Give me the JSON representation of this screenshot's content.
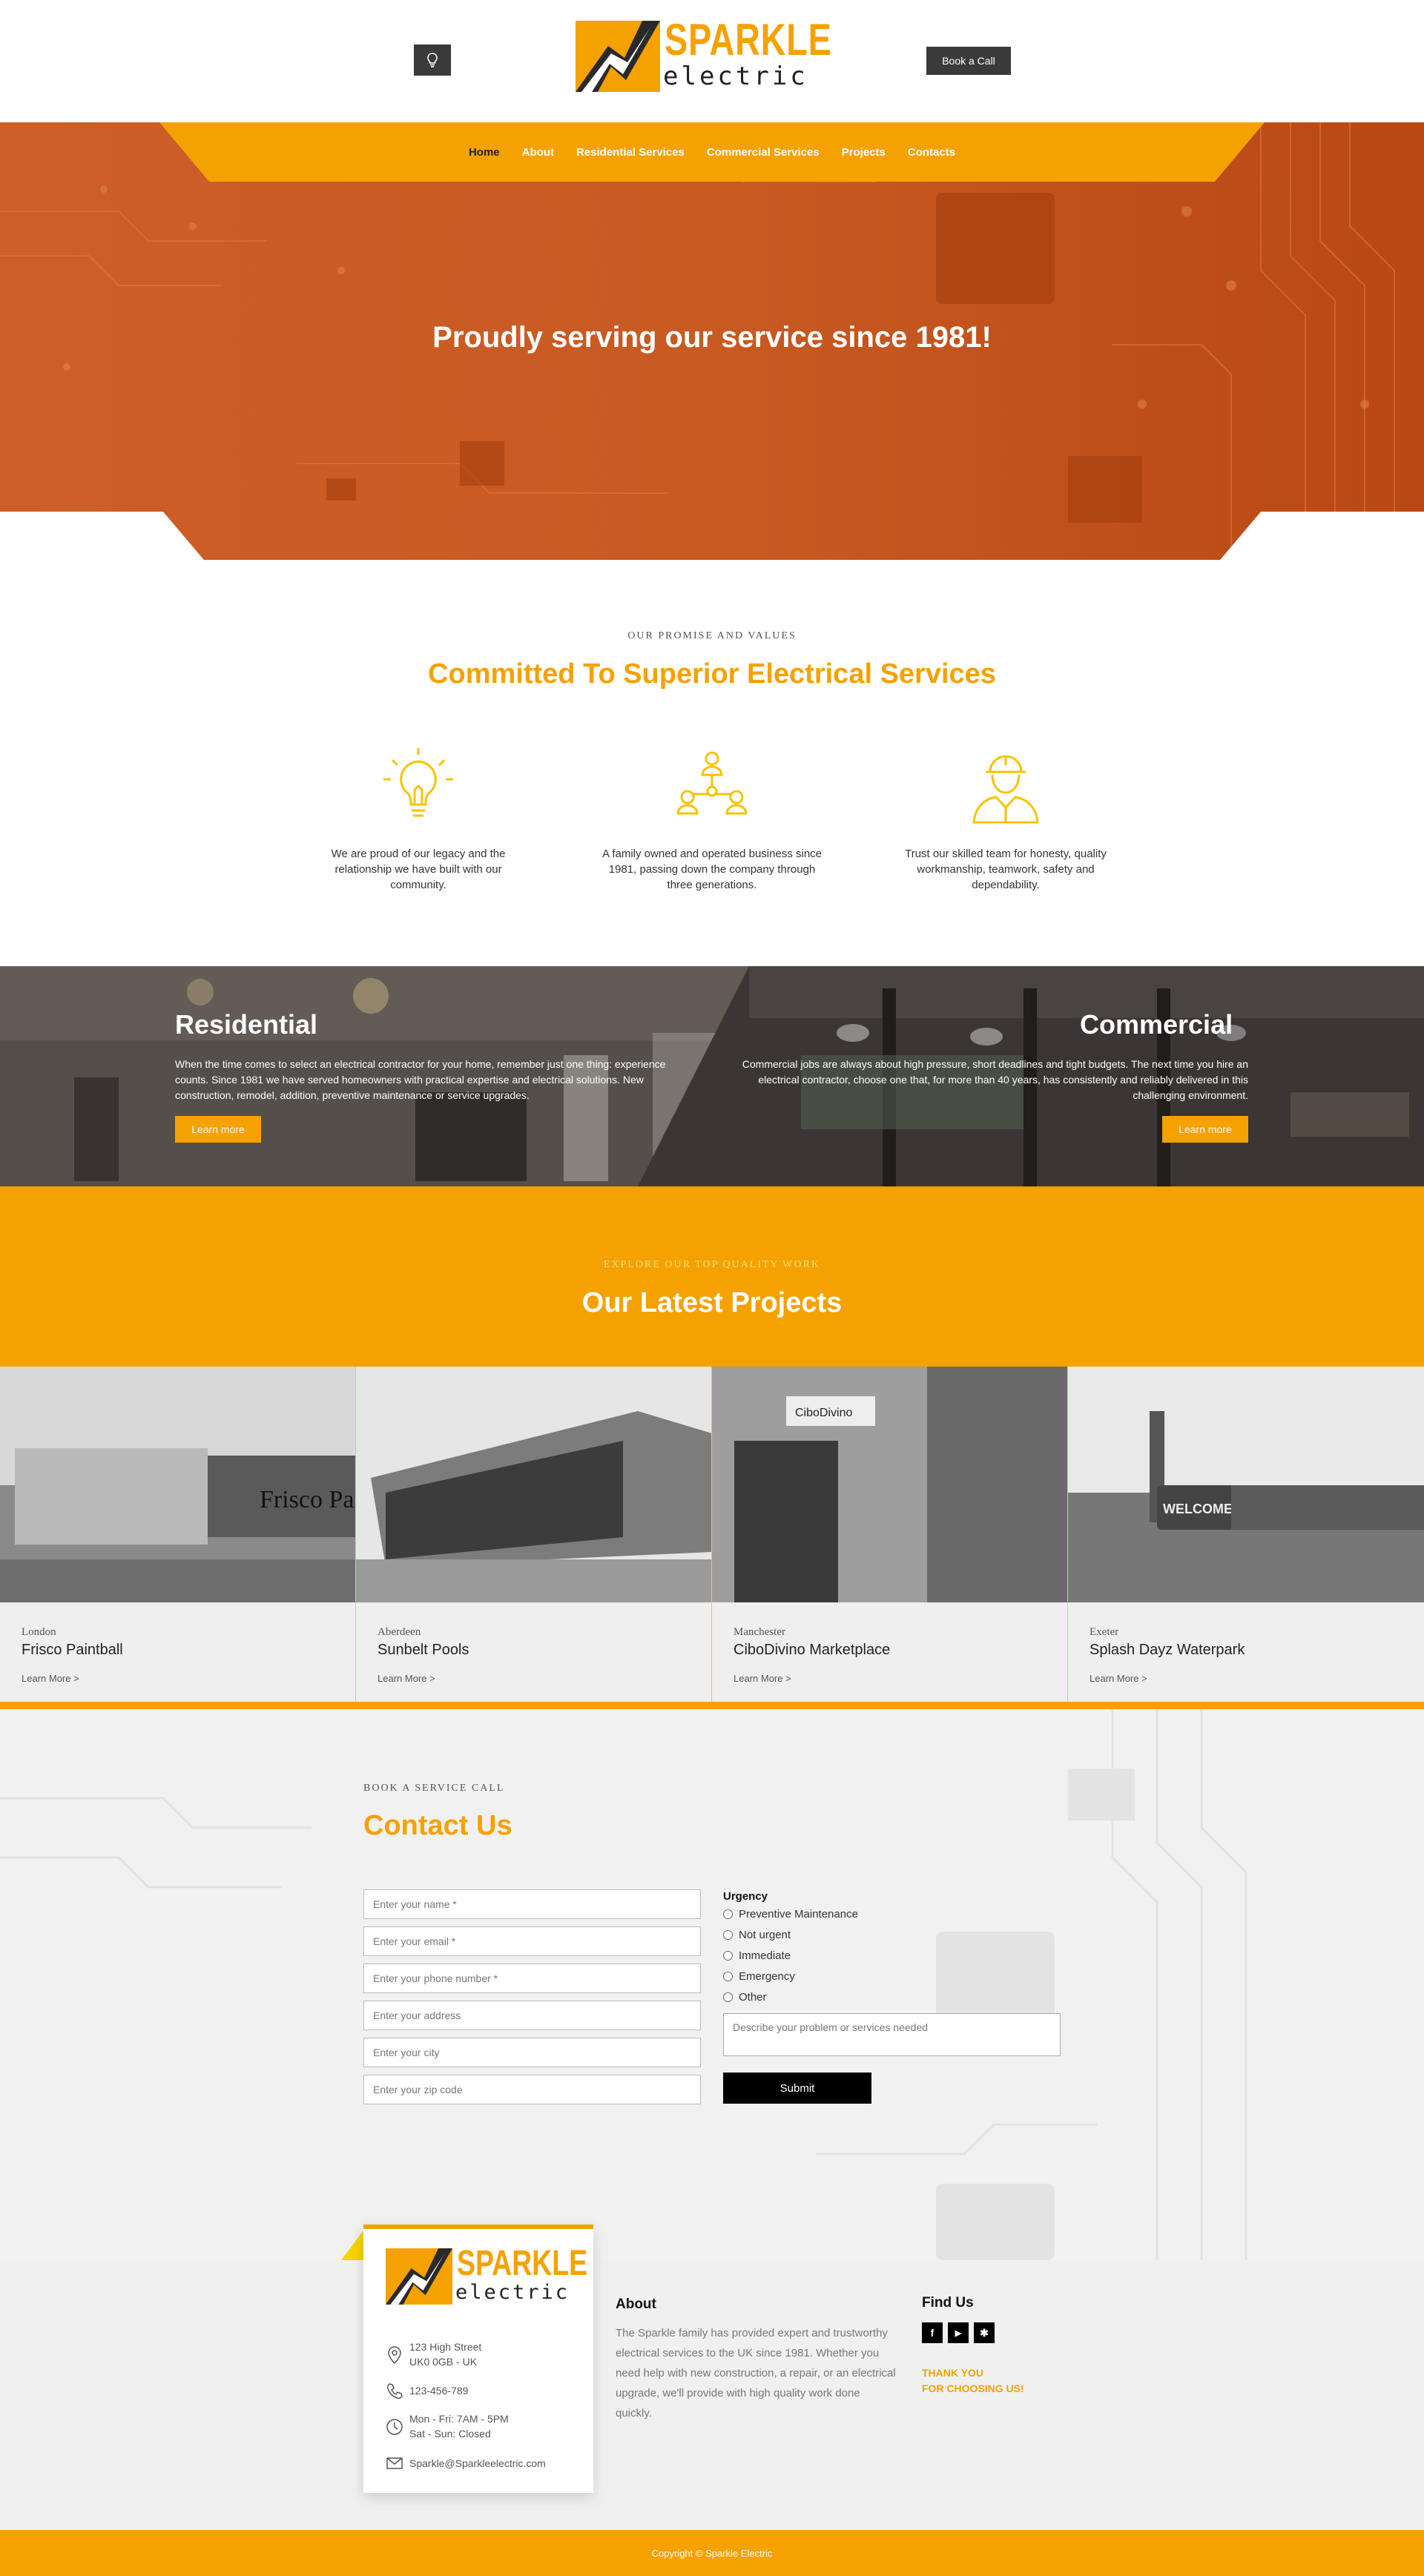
{
  "colors": {
    "brand": "#f5a100",
    "dark": "#3a3a3a",
    "hero": "#c9551c"
  },
  "header": {
    "bulb_icon": "lightbulb-icon",
    "book_call": "Book a Call",
    "logo": {
      "line1": "SPARKLE",
      "line2": "electric"
    }
  },
  "nav": {
    "items": [
      {
        "label": "Home",
        "active": true
      },
      {
        "label": "About"
      },
      {
        "label": "Residential Services"
      },
      {
        "label": "Commercial Services"
      },
      {
        "label": "Projects"
      },
      {
        "label": "Contacts"
      }
    ]
  },
  "hero": {
    "title": "Proudly serving our service since 1981!"
  },
  "values": {
    "eyebrow": "OUR PROMISE AND VALUES",
    "title": "Committed To Superior Electrical Services",
    "items": [
      {
        "icon": "lightbulb-icon",
        "text": "We are proud of our legacy and the relationship we have built with our community."
      },
      {
        "icon": "team-hierarchy-icon",
        "text": "A family owned and operated business since 1981, passing down the company through three generations."
      },
      {
        "icon": "worker-hardhat-icon",
        "text": "Trust our skilled team for honesty, quality workmanship, teamwork, safety and dependability."
      }
    ]
  },
  "services": {
    "residential": {
      "title": "Residential",
      "text": "When the time comes to select an electrical contractor for your home, remember just one thing: experience counts. Since 1981 we have served homeowners with practical expertise and electrical solutions. New construction, remodel, addition, preventive maintenance or service upgrades.",
      "button": "Learn more"
    },
    "commercial": {
      "title": "Commercial",
      "text": "Commercial jobs are always about high pressure, short deadlines and tight budgets. The next time you hire an electrical contractor, choose one that, for more than 40 years, has consistently and reliably delivered in this challenging environment.",
      "button": "Learn more"
    }
  },
  "projects": {
    "eyebrow": "EXPLORE OUR TOP QUALITY WORK",
    "title": "Our Latest Projects",
    "items": [
      {
        "city": "London",
        "title": "Frisco Paintball",
        "link": "Learn More >",
        "sign": "Frisco Paintball"
      },
      {
        "city": "Aberdeen",
        "title": "Sunbelt Pools",
        "link": "Learn More >"
      },
      {
        "city": "Manchester",
        "title": "CiboDivino Marketplace",
        "link": "Learn More >",
        "sign": "CiboDivino"
      },
      {
        "city": "Exeter",
        "title": "Splash Dayz Waterpark",
        "link": "Learn More >",
        "sign": "WELCOME"
      }
    ]
  },
  "contact": {
    "eyebrow": "BOOK A SERVICE CALL",
    "title": "Contact Us",
    "fields": [
      "Enter your name *",
      "Enter your email *",
      "Enter your phone number *",
      "Enter your address",
      "Enter your city",
      "Enter your zip code"
    ],
    "urgency_label": "Urgency",
    "urgency_options": [
      "Preventive Maintenance",
      "Not urgent",
      "Immediate",
      "Emergency",
      "Other"
    ],
    "message_placeholder": "Describe your problem or services needed",
    "submit": "Submit"
  },
  "footer": {
    "address_line1": "123 High Street",
    "address_line2": "UK0 0GB - UK",
    "phone": "123-456-789",
    "hours_line1": "Mon - Fri: 7AM - 5PM",
    "hours_line2": "Sat - Sun: Closed",
    "email": "Sparkle@Sparkleelectric.com",
    "about_title": "About",
    "about_text": "The Sparkle family has provided expert and trustworthy electrical services to the UK since 1981. Whether you need help with new construction, a repair, or an electrical upgrade, we'll provide with high quality work done quickly.",
    "find_title": "Find Us",
    "social": [
      {
        "icon": "facebook-icon",
        "glyph": "f"
      },
      {
        "icon": "youtube-icon",
        "glyph": "▶"
      },
      {
        "icon": "yelp-icon",
        "glyph": "✱"
      }
    ],
    "thanks_line1": "THANK YOU",
    "thanks_line2": "FOR CHOOSING US!",
    "copyright": "Copyright © Sparkle Electric"
  }
}
